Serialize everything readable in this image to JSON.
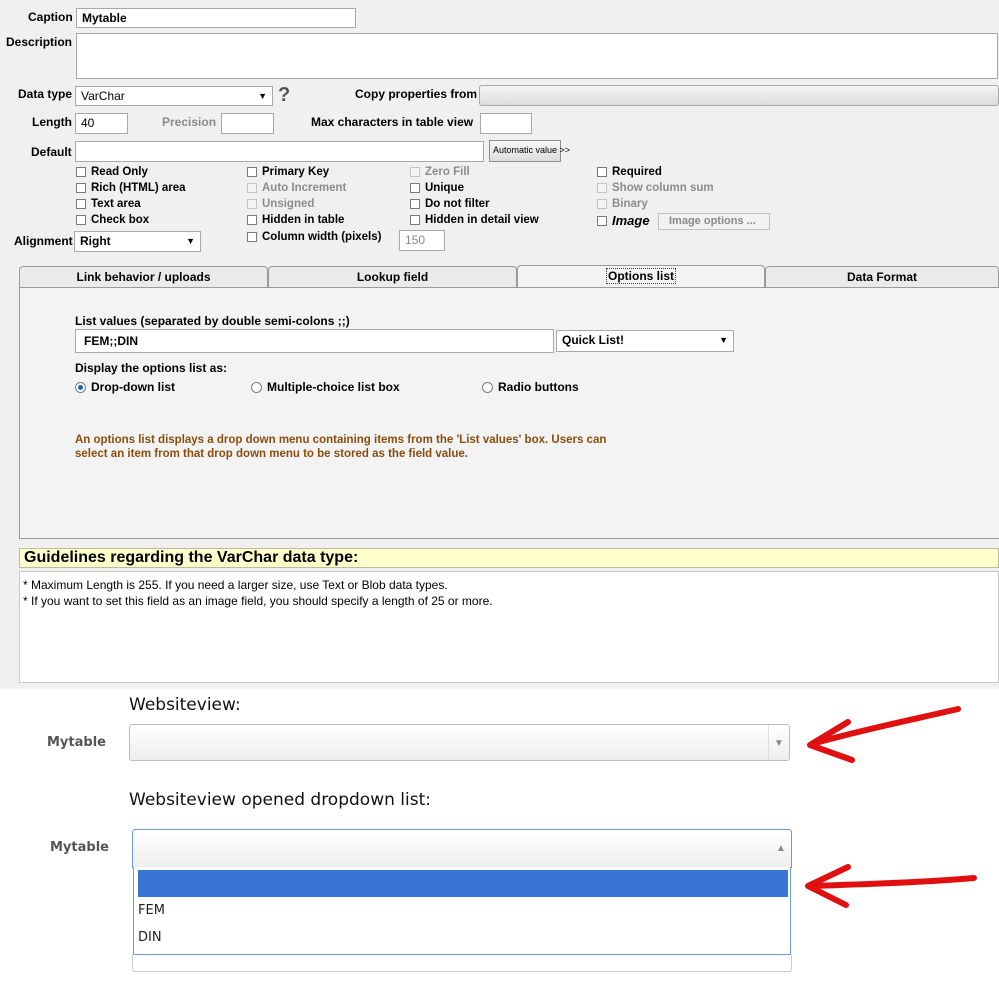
{
  "form": {
    "caption_label": "Caption",
    "caption_value": "Mytable",
    "description_label": "Description",
    "data_type_label": "Data type",
    "data_type_value": "VarChar",
    "help_icon": "?",
    "copy_props_label": "Copy properties from",
    "length_label": "Length",
    "length_value": "40",
    "precision_label": "Precision",
    "maxchars_label": "Max characters in table view",
    "default_label": "Default",
    "auto_value_button": "Automatic value >>",
    "alignment_label": "Alignment",
    "alignment_value": "Right",
    "column_width_value": "150",
    "image_options_button": "Image options ..."
  },
  "checkboxes": {
    "col1": [
      "Read Only",
      "Rich (HTML) area",
      "Text area",
      "Check box"
    ],
    "col2": [
      "Primary Key",
      "Auto Increment",
      "Unsigned",
      "Hidden in table",
      "Column width (pixels)"
    ],
    "col3": [
      "Zero Fill",
      "Unique",
      "Do not filter",
      "Hidden in detail view"
    ],
    "col4": [
      "Required",
      "Show column sum",
      "Binary",
      "Image"
    ]
  },
  "tabs": [
    "Link behavior / uploads",
    "Lookup field",
    "Options list",
    "Data Format"
  ],
  "options_tab": {
    "list_values_label": "List values (separated by double semi-colons ;;)",
    "list_values_value": "FEM;;DIN",
    "quick_list": "Quick List!",
    "display_as_label": "Display the options list as:",
    "radio_dropdown": "Drop-down list",
    "radio_multi": "Multiple-choice list box",
    "radio_buttons": "Radio buttons",
    "note_line1": "An options list displays a drop down menu containing items from the 'List values' box. Users can",
    "note_line2": "select an item from that drop down menu to be stored as the field value."
  },
  "guidelines": {
    "title": "Guidelines regarding the VarChar data type:",
    "line1": "* Maximum Length is 255. If you need a larger size, use Text or Blob data types.",
    "line2": "* If you want to set this field as an image field, you should specify a length of 25 or more."
  },
  "website": {
    "heading1": "Websiteview:",
    "field_label": "Mytable",
    "heading2": "Websiteview opened dropdown list:",
    "options": [
      "",
      "FEM",
      "DIN"
    ]
  },
  "colors": {
    "highlight": "#3a74d4",
    "arrow_red": "#e01010",
    "note_text": "#8a4d0e",
    "guide_bg": "#ffffcc"
  }
}
